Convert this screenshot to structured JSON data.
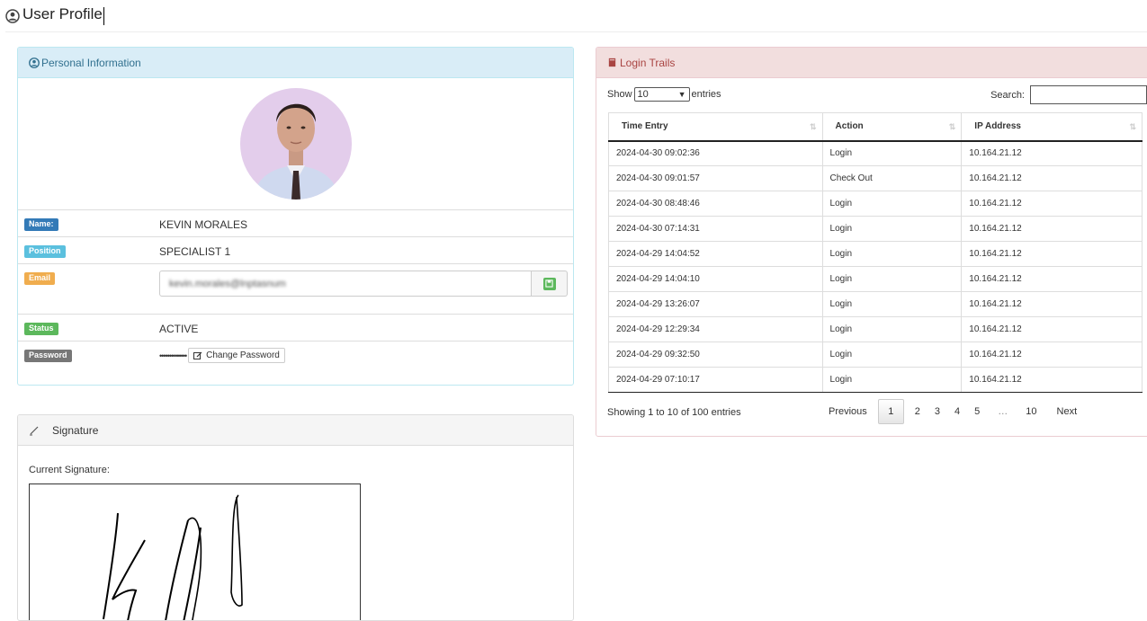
{
  "page": {
    "title": "User Profile",
    "title_icon": "user-circle-icon"
  },
  "personal": {
    "heading": "Personal Information",
    "heading_icon": "user-circle-icon",
    "avatar_icon": "profile-photo",
    "name_label": "Name:",
    "name_value": "KEVIN MORALES",
    "position_label": "Position",
    "position_value": "SPECIALIST 1",
    "email_label": "Email",
    "email_value": "kevin.morales@lnptasnum",
    "email_save_icon": "floppy-disk-icon",
    "status_label": "Status",
    "status_value": "ACTIVE",
    "password_label": "Password",
    "password_value": "••••••••••••••",
    "change_password_label": "Change Password",
    "change_password_icon": "edit-icon",
    "colors": {
      "name_badge": "#337ab7",
      "position_badge": "#5bc0de",
      "email_badge": "#f0ad4e",
      "status_badge": "#5cb85c",
      "password_badge": "#777777"
    }
  },
  "signature": {
    "heading": "Signature",
    "heading_icon": "pencil-icon",
    "current_label": "Current Signature:"
  },
  "login_trails": {
    "heading": "Login Trails",
    "heading_icon": "book-icon",
    "show_label": "Show",
    "entries_label": "entries",
    "page_size": "10",
    "search_label": "Search:",
    "search_value": "",
    "columns": [
      "Time Entry",
      "Action",
      "IP Address"
    ],
    "rows": [
      [
        "2024-04-30 09:02:36",
        "Login",
        "10.164.21.12"
      ],
      [
        "2024-04-30 09:01:57",
        "Check Out",
        "10.164.21.12"
      ],
      [
        "2024-04-30 08:48:46",
        "Login",
        "10.164.21.12"
      ],
      [
        "2024-04-30 07:14:31",
        "Login",
        "10.164.21.12"
      ],
      [
        "2024-04-29 14:04:52",
        "Login",
        "10.164.21.12"
      ],
      [
        "2024-04-29 14:04:10",
        "Login",
        "10.164.21.12"
      ],
      [
        "2024-04-29 13:26:07",
        "Login",
        "10.164.21.12"
      ],
      [
        "2024-04-29 12:29:34",
        "Login",
        "10.164.21.12"
      ],
      [
        "2024-04-29 09:32:50",
        "Login",
        "10.164.21.12"
      ],
      [
        "2024-04-29 07:10:17",
        "Login",
        "10.164.21.12"
      ]
    ],
    "info": "Showing 1 to 10 of 100 entries",
    "pagination": {
      "previous": "Previous",
      "pages": [
        "1",
        "2",
        "3",
        "4",
        "5"
      ],
      "ellipsis": "…",
      "last": "10",
      "next": "Next",
      "current": "1"
    }
  }
}
